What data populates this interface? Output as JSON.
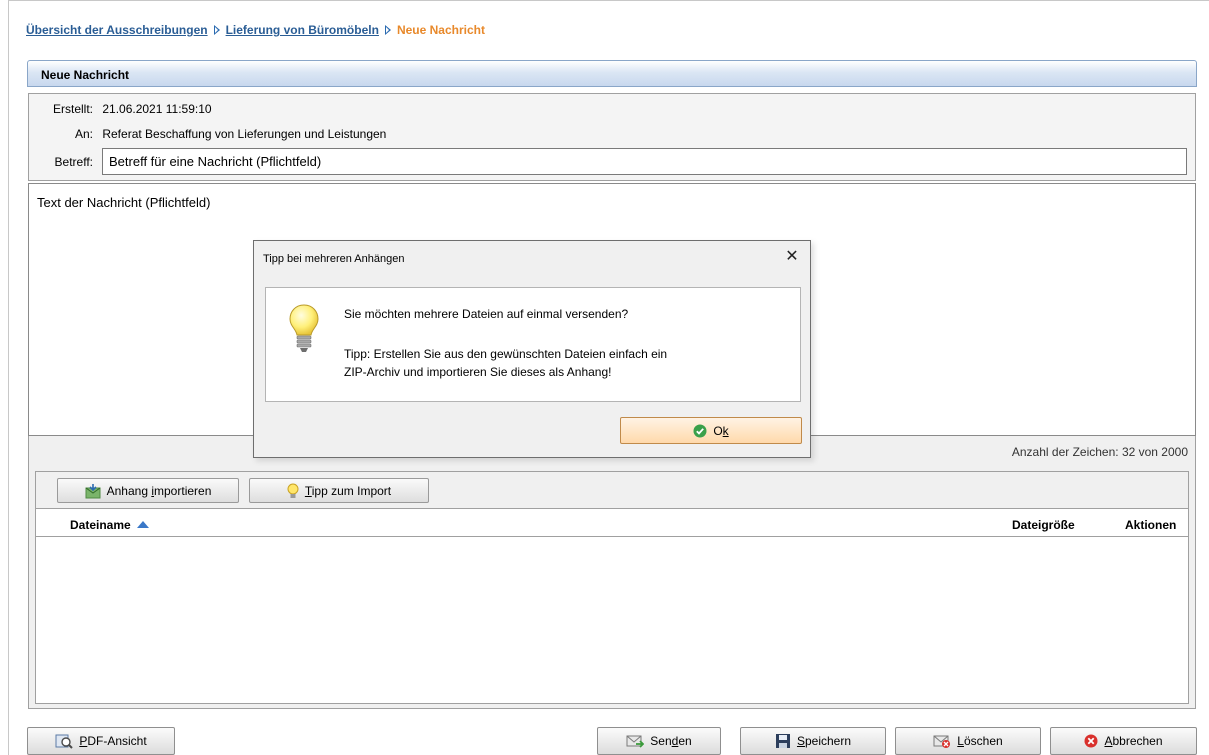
{
  "breadcrumb": {
    "items": [
      "Übersicht der Ausschreibungen",
      "Lieferung von Büromöbeln"
    ],
    "current": "Neue Nachricht"
  },
  "panel": {
    "title": "Neue Nachricht"
  },
  "meta": {
    "created_label": "Erstellt:",
    "created_value": "21.06.2021 11:59:10",
    "to_label": "An:",
    "to_value": "Referat Beschaffung von Lieferungen und Leistungen",
    "subject_label": "Betreff:",
    "subject_value": "Betreff für eine Nachricht (Pflichtfeld)"
  },
  "message": {
    "text": "Text der Nachricht (Pflichtfeld)"
  },
  "counter": {
    "text": "Anzahl der Zeichen: 32 von 2000"
  },
  "attachments": {
    "import_button": {
      "pre": "Anhang ",
      "key": "i",
      "post": "mportieren",
      "icon": "import-attachment-icon"
    },
    "tip_button": {
      "key": "T",
      "post": "ipp zum Import",
      "icon": "lightbulb-icon"
    },
    "columns": {
      "filename": "Dateiname",
      "filesize": "Dateigröße",
      "actions": "Aktionen"
    },
    "rows": []
  },
  "buttons": {
    "pdf": {
      "key": "P",
      "post": "DF-Ansicht",
      "icon": "pdf-view-icon"
    },
    "send": {
      "pre": "Sen",
      "key": "d",
      "post": "en",
      "icon": "send-mail-icon"
    },
    "save": {
      "key": "S",
      "post": "peichern",
      "icon": "floppy-disk-icon"
    },
    "delete": {
      "key": "L",
      "post": "öschen",
      "icon": "delete-mail-icon"
    },
    "cancel": {
      "key": "A",
      "post": "bbrechen",
      "icon": "cancel-icon"
    }
  },
  "dialog": {
    "title": "Tipp bei mehreren Anhängen",
    "line1": "Sie möchten mehrere Dateien auf einmal versenden?",
    "line2": "Tipp: Erstellen Sie aus den gewünschten Dateien einfach ein",
    "line3": "ZIP-Archiv und importieren Sie dieses als Anhang!",
    "ok": {
      "pre": "O",
      "key": "k"
    },
    "icon": "lightbulb-icon"
  },
  "colors": {
    "link": "#2a5d95",
    "current_crumb": "#e8892b",
    "header_gradient_end": "#c8d8ee",
    "ok_button": "#ffd9ab",
    "cancel_red": "#d9302c"
  }
}
